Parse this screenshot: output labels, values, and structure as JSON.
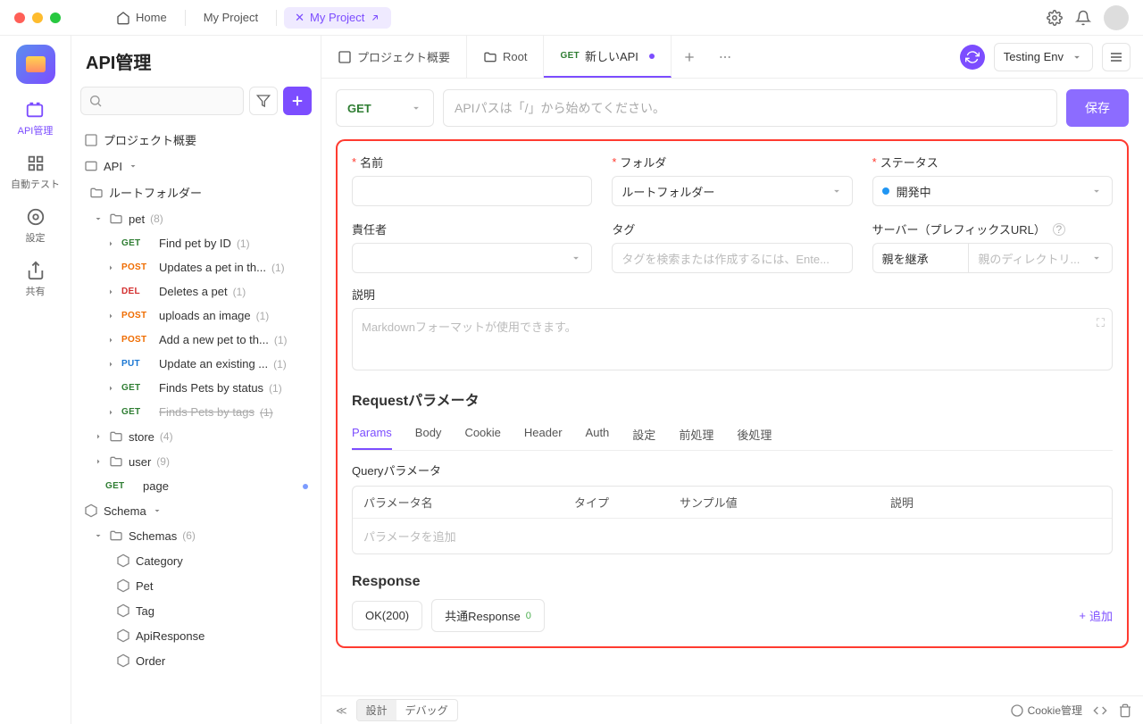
{
  "titlebar": {
    "home": "Home",
    "project": "My Project",
    "project_active": "My Project"
  },
  "rail": {
    "api": "API管理",
    "autotest": "自動テスト",
    "settings": "設定",
    "share": "共有"
  },
  "sidebar": {
    "title": "API管理",
    "project_overview": "プロジェクト概要",
    "api": "API",
    "root_folder": "ルートフォルダー",
    "pet": {
      "label": "pet",
      "count": "(8)"
    },
    "pet_items": [
      {
        "method": "GET",
        "cls": "m-get",
        "label": "Find pet by ID",
        "count": "(1)"
      },
      {
        "method": "POST",
        "cls": "m-post",
        "label": "Updates a pet in th...",
        "count": "(1)"
      },
      {
        "method": "DEL",
        "cls": "m-del",
        "label": "Deletes a pet",
        "count": "(1)"
      },
      {
        "method": "POST",
        "cls": "m-post",
        "label": "uploads an image",
        "count": "(1)"
      },
      {
        "method": "POST",
        "cls": "m-post",
        "label": "Add a new pet to th...",
        "count": "(1)"
      },
      {
        "method": "PUT",
        "cls": "m-put",
        "label": "Update an existing ...",
        "count": "(1)"
      },
      {
        "method": "GET",
        "cls": "m-get",
        "label": "Finds Pets by status",
        "count": "(1)"
      },
      {
        "method": "GET",
        "cls": "m-get",
        "label": "Finds Pets by tags",
        "count": "(1)",
        "strike": true
      }
    ],
    "store": {
      "label": "store",
      "count": "(4)"
    },
    "user": {
      "label": "user",
      "count": "(9)"
    },
    "page": {
      "method": "GET",
      "label": "page"
    },
    "schema_group": "Schema",
    "schemas": {
      "label": "Schemas",
      "count": "(6)"
    },
    "schema_items": [
      "Category",
      "Pet",
      "Tag",
      "ApiResponse",
      "Order"
    ]
  },
  "tabs": {
    "overview": "プロジェクト概要",
    "root": "Root",
    "new_api_method": "GET",
    "new_api": "新しいAPI"
  },
  "env": {
    "label": "Testing Env"
  },
  "editor": {
    "method": "GET",
    "url_placeholder": "APIパスは「/」から始めてください。",
    "save": "保存",
    "name": "名前",
    "folder": "フォルダ",
    "folder_value": "ルートフォルダー",
    "status": "ステータス",
    "status_value": "開発中",
    "owner": "責任者",
    "tags": "タグ",
    "tags_placeholder": "タグを検索または作成するには、Ente...",
    "server": "サーバー（プレフィックスURL）",
    "server_value": "親を継承",
    "server_placeholder": "親のディレクトリ...",
    "desc": "説明",
    "desc_placeholder": "Markdownフォーマットが使用できます。",
    "request_title": "Requestパラメータ",
    "param_tabs": [
      "Params",
      "Body",
      "Cookie",
      "Header",
      "Auth",
      "設定",
      "前処理",
      "後処理"
    ],
    "query_label": "Queryパラメータ",
    "table_head": [
      "パラメータ名",
      "タイプ",
      "サンプル値",
      "説明"
    ],
    "table_placeholder": "パラメータを追加",
    "response_title": "Response",
    "resp_ok": "OK(200)",
    "resp_common": "共通Response",
    "resp_common_count": "0",
    "add": "追加"
  },
  "footer": {
    "design": "設計",
    "debug": "デバッグ",
    "cookie": "Cookie管理"
  }
}
